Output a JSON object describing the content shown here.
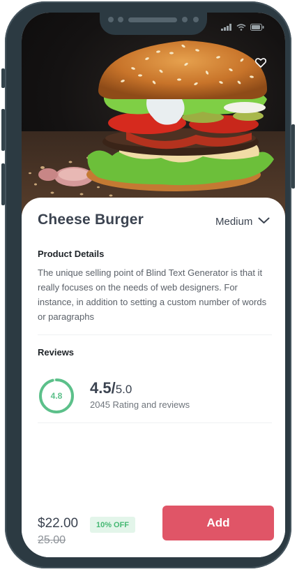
{
  "product": {
    "title": "Cheese Burger",
    "size": "Medium",
    "details_heading": "Product Details",
    "description": "The unique selling point of Blind Text Generator is that it really focuses on the needs of web designers. For instance, in addition to setting a custom number of words or paragraphs"
  },
  "reviews": {
    "heading": "Reviews",
    "score": "4.8",
    "score_fraction": 0.96,
    "rating": "4.5/",
    "rating_max": "5.0",
    "summary": "2045 Rating and reviews"
  },
  "pricing": {
    "price": "$22.00",
    "old_price": "25.00",
    "discount": "10% OFF",
    "add_label": "Add"
  },
  "colors": {
    "accent": "#e05567",
    "success": "#5cc08a",
    "frame": "#2c3a42"
  },
  "icons": {
    "favorite": "heart-outline-icon",
    "dropdown": "chevron-down-icon",
    "signal": "signal-icon",
    "wifi": "wifi-icon",
    "battery": "battery-icon"
  }
}
